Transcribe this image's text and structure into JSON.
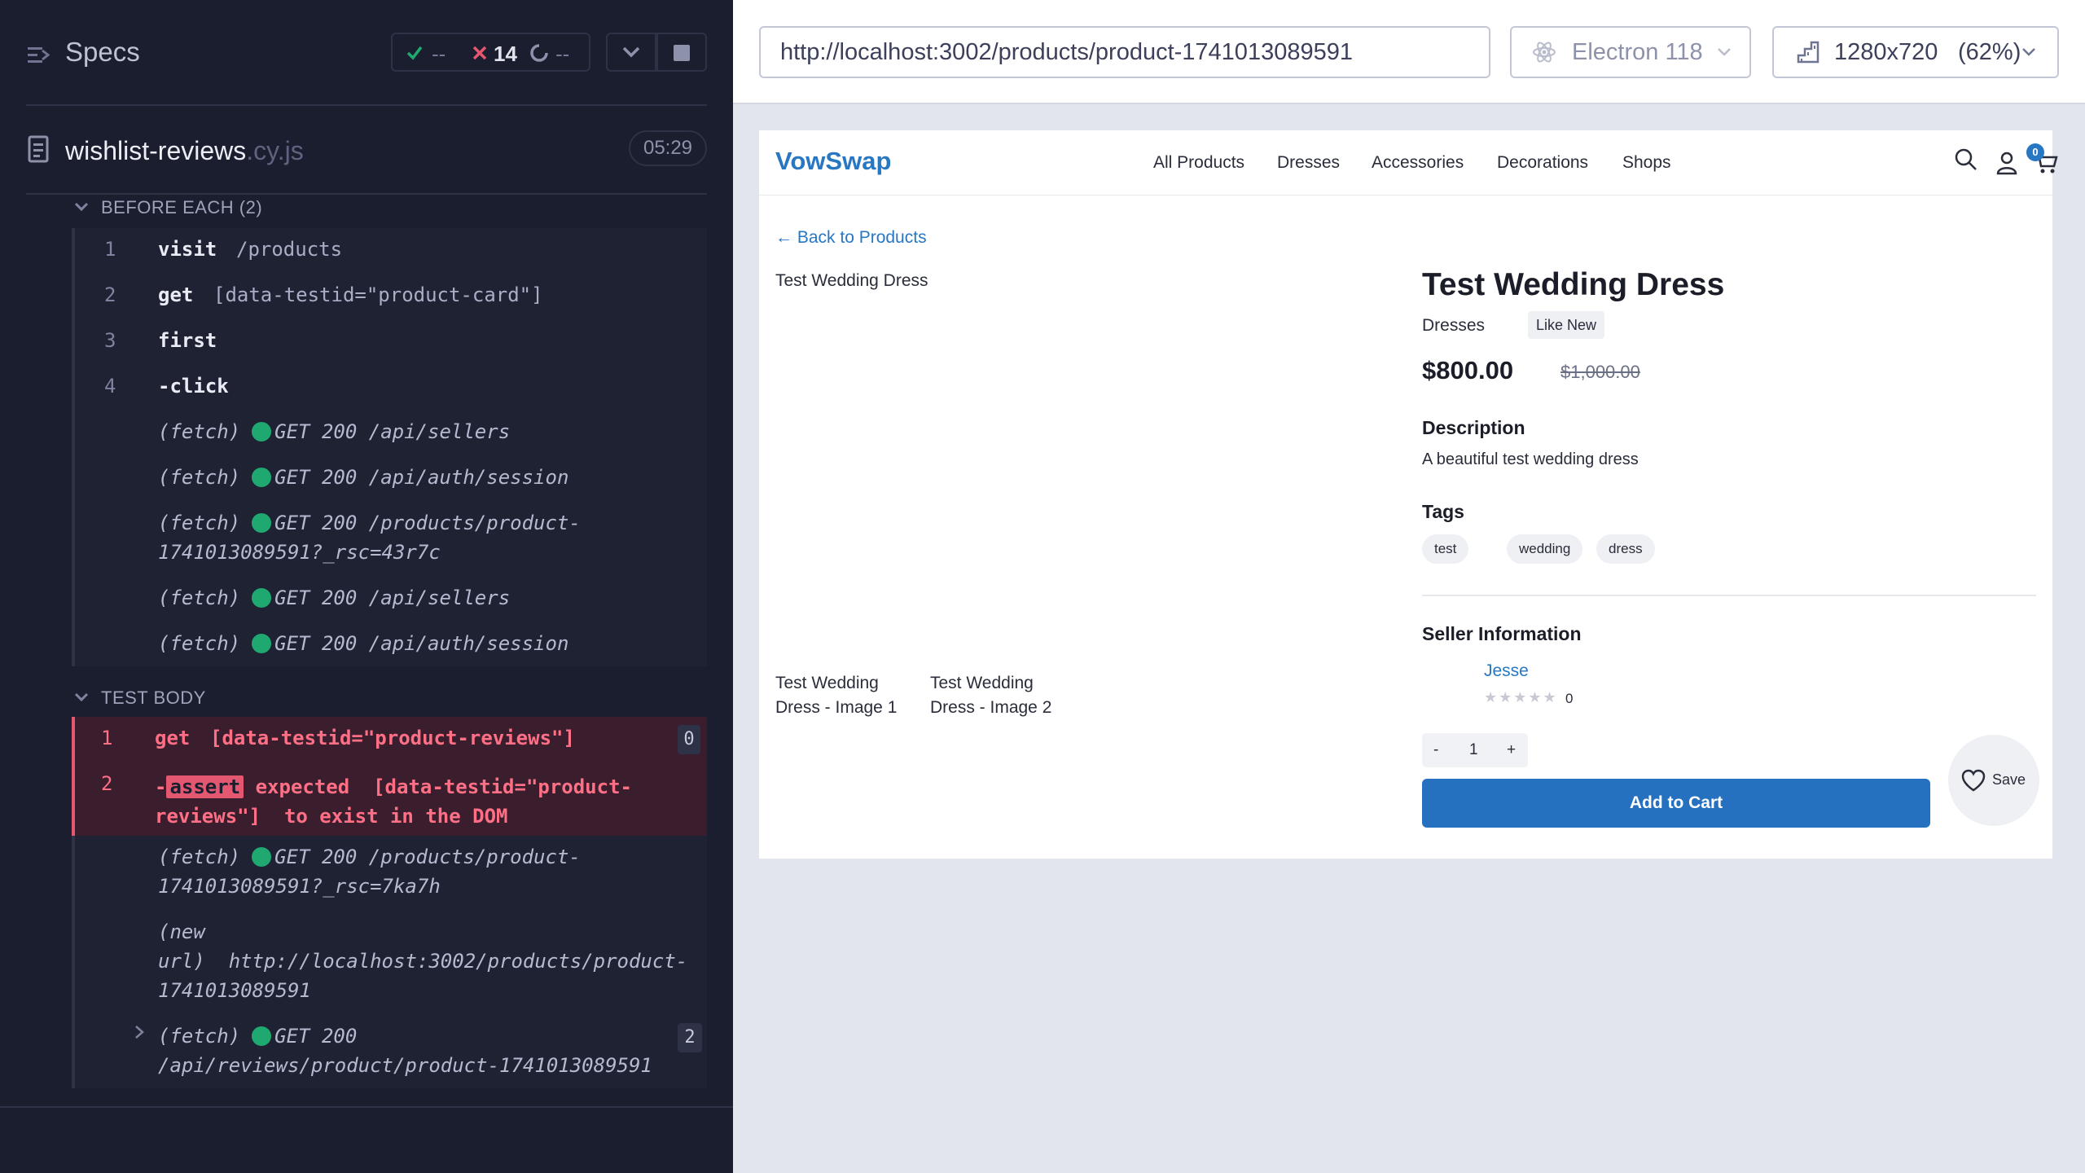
{
  "reporter": {
    "title": "Specs",
    "stats": {
      "passed": "--",
      "failed": "14",
      "pending": "--"
    },
    "spec": {
      "name": "wishlist-reviews",
      "ext": ".cy.js",
      "duration": "05:29"
    },
    "before_each": {
      "title": "BEFORE EACH (2)",
      "commands": [
        {
          "num": "1",
          "name": "visit",
          "msg": "/products"
        },
        {
          "num": "2",
          "name": "get",
          "msg": "[data-testid=\"product-card\"]"
        },
        {
          "num": "3",
          "name": "first",
          "msg": ""
        },
        {
          "num": "4",
          "name": "-click",
          "msg": ""
        }
      ],
      "logs": [
        {
          "type": "(fetch)",
          "text": "GET 200 /api/sellers"
        },
        {
          "type": "(fetch)",
          "text": "GET 200 /api/auth/session"
        },
        {
          "type": "(fetch)",
          "text": "GET 200 /products/product-",
          "cont": "1741013089591?_rsc=43r7c"
        },
        {
          "type": "(fetch)",
          "text": "GET 200 /api/sellers"
        },
        {
          "type": "(fetch)",
          "text": "GET 200 /api/auth/session"
        }
      ]
    },
    "test_body": {
      "title": "TEST BODY",
      "cmd1": {
        "num": "1",
        "name": "get",
        "msg": "[data-testid=\"product-reviews\"]",
        "badge": "0"
      },
      "cmd2": {
        "num": "2",
        "prefix": "-",
        "badge": "assert",
        "line1": " expected  [data-testid=\"product-",
        "line2": "reviews\"]  to exist in the DOM"
      },
      "log1": {
        "type": "(fetch)",
        "text": "GET 200 /products/product-",
        "cont": "1741013089591?_rsc=7ka7h"
      },
      "log2": {
        "l1": "(new",
        "l2": "url)",
        "url": "http://localhost:3002/products/product-",
        "cont": "1741013089591"
      },
      "log3": {
        "type": "(fetch)",
        "text": "GET 200",
        "cont": "/api/reviews/product/product-1741013089591",
        "badge": "2"
      }
    }
  },
  "aut_header": {
    "url": "http://localhost:3002/products/product-1741013089591",
    "browser": "Electron 118",
    "viewport": "1280x720",
    "scale": "(62%)"
  },
  "app": {
    "brand": "VowSwap",
    "nav": [
      "All Products",
      "Dresses",
      "Accessories",
      "Decorations",
      "Shops"
    ],
    "cart_count": "0",
    "back": "← Back to Products",
    "main_image_alt": "Test Wedding Dress",
    "thumb1_alt_l1": "Test Wedding",
    "thumb1_alt_l2": "Dress - Image 1",
    "thumb2_alt_l1": "Test Wedding",
    "thumb2_alt_l2": "Dress - Image 2",
    "title": "Test Wedding Dress",
    "category": "Dresses",
    "condition": "Like New",
    "price": "$800.00",
    "original_price": "$1,000.00",
    "description_title": "Description",
    "description": "A beautiful test wedding dress",
    "tags_title": "Tags",
    "tags": [
      "test",
      "wedding",
      "dress"
    ],
    "seller_title": "Seller Information",
    "seller_name": "Jesse",
    "rating_stars": "★★★★★",
    "rating_count": "0",
    "qty_minus": "-",
    "qty": "1",
    "qty_plus": "+",
    "add_to_cart": "Add to Cart",
    "save": "Save"
  }
}
